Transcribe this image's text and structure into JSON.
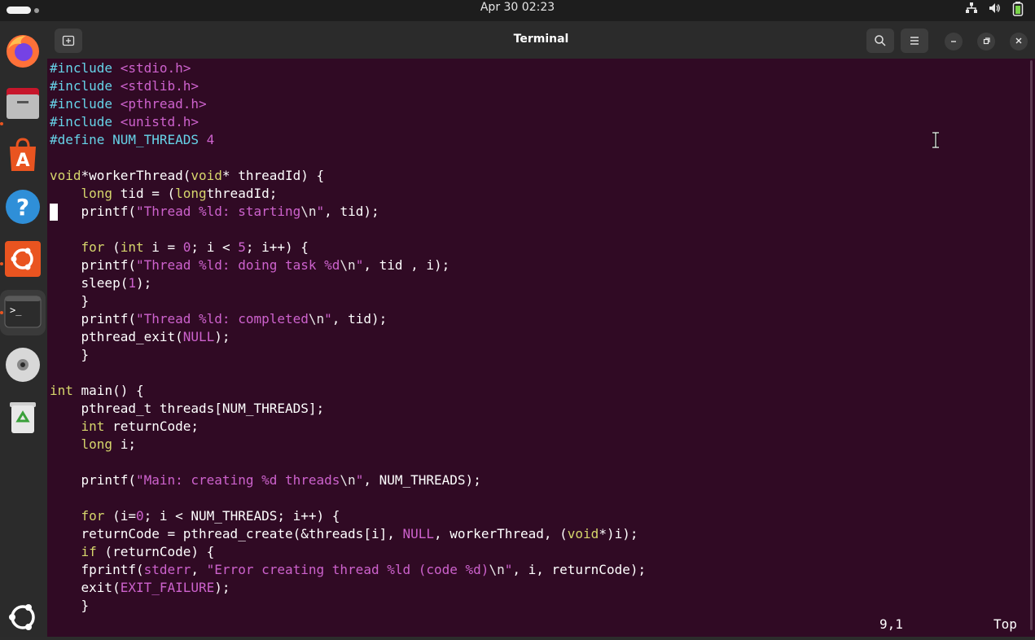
{
  "topbar": {
    "datetime": "Apr 30  02:23",
    "tray_icons": [
      "network-icon",
      "volume-icon",
      "battery-icon"
    ]
  },
  "dock": {
    "items": [
      {
        "name": "firefox-icon",
        "running": false
      },
      {
        "name": "files-icon",
        "running": true
      },
      {
        "name": "app-center-icon",
        "running": false
      },
      {
        "name": "help-icon",
        "running": false
      },
      {
        "name": "ubuntu-installer-icon",
        "running": true
      },
      {
        "name": "terminal-icon",
        "running": true,
        "active": true
      },
      {
        "name": "dvd-icon",
        "running": false
      },
      {
        "name": "trash-icon",
        "running": false
      },
      {
        "name": "show-apps-icon",
        "running": false
      }
    ],
    "terminal_glyph": ">_"
  },
  "window": {
    "title": "Terminal",
    "new_tab_icon": "new-tab-icon",
    "search_icon": "search-icon",
    "menu_icon": "hamburger-menu-icon",
    "minimize_icon": "minimize-icon",
    "maximize_icon": "restore-icon",
    "close_icon": "close-icon"
  },
  "editor": {
    "lines": [
      [
        [
          "pp",
          "#include "
        ],
        [
          "str",
          "<stdio.h>"
        ]
      ],
      [
        [
          "pp",
          "#include "
        ],
        [
          "str",
          "<stdlib.h>"
        ]
      ],
      [
        [
          "pp",
          "#include "
        ],
        [
          "str",
          "<pthread.h>"
        ]
      ],
      [
        [
          "pp",
          "#include "
        ],
        [
          "str",
          "<unistd.h>"
        ]
      ],
      [
        [
          "pp",
          "#define NUM_THREADS "
        ],
        [
          "num",
          "4"
        ]
      ],
      [],
      [
        [
          "kw",
          "void"
        ],
        [
          "",
          "*workerThread("
        ],
        [
          "kw",
          "void"
        ],
        [
          "",
          "* threadId) {"
        ]
      ],
      [
        [
          "",
          "    "
        ],
        [
          "kw",
          "long"
        ],
        [
          "",
          " tid = ("
        ],
        [
          "kw",
          "long"
        ],
        [
          "",
          "threadId;"
        ]
      ],
      [
        [
          "",
          "    printf("
        ],
        [
          "str",
          "\"Thread %ld: starting"
        ],
        [
          "esc",
          "\\n"
        ],
        [
          "str",
          "\""
        ],
        [
          "",
          ", tid);"
        ]
      ],
      [],
      [
        [
          "",
          "    "
        ],
        [
          "kw",
          "for"
        ],
        [
          "",
          " ("
        ],
        [
          "kw",
          "int"
        ],
        [
          "",
          " i = "
        ],
        [
          "num",
          "0"
        ],
        [
          "",
          "; i < "
        ],
        [
          "num",
          "5"
        ],
        [
          "",
          "; i++) {"
        ]
      ],
      [
        [
          "",
          "    printf("
        ],
        [
          "str",
          "\"Thread %ld: doing task %d"
        ],
        [
          "esc",
          "\\n"
        ],
        [
          "str",
          "\""
        ],
        [
          "",
          ", tid , i);"
        ]
      ],
      [
        [
          "",
          "    sleep("
        ],
        [
          "num",
          "1"
        ],
        [
          "",
          ");"
        ]
      ],
      [
        [
          "",
          "    }"
        ]
      ],
      [
        [
          "",
          "    printf("
        ],
        [
          "str",
          "\"Thread %ld: completed"
        ],
        [
          "esc",
          "\\n"
        ],
        [
          "str",
          "\""
        ],
        [
          "",
          ", tid);"
        ]
      ],
      [
        [
          "",
          "    pthread_exit("
        ],
        [
          "con",
          "NULL"
        ],
        [
          "",
          ");"
        ]
      ],
      [
        [
          "",
          "    }"
        ]
      ],
      [],
      [
        [
          "kw",
          "int"
        ],
        [
          "",
          " main() {"
        ]
      ],
      [
        [
          "",
          "    pthread_t threads[NUM_THREADS];"
        ]
      ],
      [
        [
          "",
          "    "
        ],
        [
          "kw",
          "int"
        ],
        [
          "",
          " returnCode;"
        ]
      ],
      [
        [
          "",
          "    "
        ],
        [
          "kw",
          "long"
        ],
        [
          "",
          " i;"
        ]
      ],
      [],
      [
        [
          "",
          "    printf("
        ],
        [
          "str",
          "\"Main: creating %d threads"
        ],
        [
          "esc",
          "\\n"
        ],
        [
          "str",
          "\""
        ],
        [
          "",
          ", NUM_THREADS);"
        ]
      ],
      [],
      [
        [
          "",
          "    "
        ],
        [
          "kw",
          "for"
        ],
        [
          "",
          " (i="
        ],
        [
          "num",
          "0"
        ],
        [
          "",
          "; i < NUM_THREADS; i++) {"
        ]
      ],
      [
        [
          "",
          "    returnCode = pthread_create(&threads[i], "
        ],
        [
          "con",
          "NULL"
        ],
        [
          "",
          ", workerThread, ("
        ],
        [
          "kw",
          "void"
        ],
        [
          "",
          "*)i);"
        ]
      ],
      [
        [
          "",
          "    "
        ],
        [
          "kw",
          "if"
        ],
        [
          "",
          " (returnCode) {"
        ]
      ],
      [
        [
          "",
          "    fprintf("
        ],
        [
          "con",
          "stderr"
        ],
        [
          "",
          ", "
        ],
        [
          "str",
          "\"Error creating thread %ld (code %d)"
        ],
        [
          "esc",
          "\\n"
        ],
        [
          "str",
          "\""
        ],
        [
          "",
          ", i, returnCode);"
        ]
      ],
      [
        [
          "",
          "    exit("
        ],
        [
          "con",
          "EXIT_FAILURE"
        ],
        [
          "",
          ");"
        ]
      ],
      [
        [
          "",
          "    }"
        ]
      ]
    ],
    "position": "9,1",
    "scroll": "Top"
  },
  "colors": {
    "terminal_bg": "#300a24",
    "preprocessor": "#66d3e8",
    "string": "#cd62cd",
    "keyword": "#d6d66c",
    "accent": "#e95420"
  }
}
